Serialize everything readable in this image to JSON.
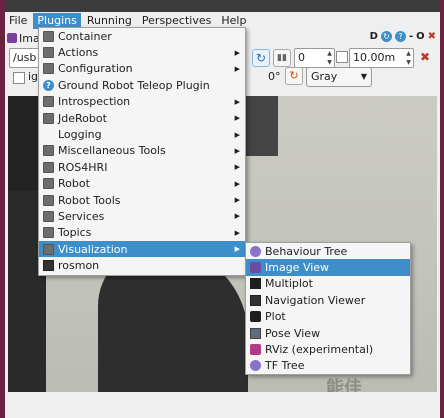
{
  "menubar": {
    "items": [
      "File",
      "Plugins",
      "Running",
      "Perspectives",
      "Help"
    ],
    "active": "Plugins"
  },
  "plugin": {
    "title": "Imag",
    "title_buttons": [
      "D",
      "?",
      "-",
      "O",
      "✖"
    ]
  },
  "toolbar": {
    "topic_value": "/usb",
    "number_value": "0",
    "distance_value": "10.00m",
    "checkbox_label": "ig",
    "rotation_label": "0°",
    "color_value": "Gray"
  },
  "plugins_menu": {
    "items": [
      {
        "label": "Container",
        "icon": "folder-icon",
        "arrow": false
      },
      {
        "label": "Actions",
        "icon": "folder-icon",
        "arrow": true
      },
      {
        "label": "Configuration",
        "icon": "folder-icon",
        "arrow": true
      },
      {
        "label": "Ground Robot Teleop Plugin",
        "icon": "help-icon",
        "arrow": false
      },
      {
        "label": "Introspection",
        "icon": "folder-icon",
        "arrow": true
      },
      {
        "label": "JdeRobot",
        "icon": "folder-icon",
        "arrow": true
      },
      {
        "label": "Logging",
        "icon": "blank-icon",
        "arrow": true
      },
      {
        "label": "Miscellaneous Tools",
        "icon": "folder-icon",
        "arrow": true
      },
      {
        "label": "ROS4HRI",
        "icon": "folder-icon",
        "arrow": true
      },
      {
        "label": "Robot",
        "icon": "folder-icon",
        "arrow": true
      },
      {
        "label": "Robot Tools",
        "icon": "folder-icon",
        "arrow": true
      },
      {
        "label": "Services",
        "icon": "folder-icon",
        "arrow": true
      },
      {
        "label": "Topics",
        "icon": "folder-icon",
        "arrow": true
      },
      {
        "label": "Visualization",
        "icon": "folder-icon",
        "arrow": true
      },
      {
        "label": "rosmon",
        "icon": "monitor-icon",
        "arrow": false
      }
    ],
    "highlighted": "Visualization"
  },
  "viz_menu": {
    "items": [
      {
        "label": "Behaviour Tree",
        "icon": "tree-icon"
      },
      {
        "label": "Image View",
        "icon": "image-icon"
      },
      {
        "label": "Multiplot",
        "icon": "multiplot-icon"
      },
      {
        "label": "Navigation Viewer",
        "icon": "monitor-icon"
      },
      {
        "label": "Plot",
        "icon": "plot-icon"
      },
      {
        "label": "Pose View",
        "icon": "pose-icon"
      },
      {
        "label": "RViz (experimental)",
        "icon": "rviz-icon"
      },
      {
        "label": "TF Tree",
        "icon": "tftree-icon"
      }
    ],
    "highlighted": "Image View"
  },
  "watermark": "能佳",
  "colors": {
    "highlight": "#3d8ec9",
    "frame": "#6b2140"
  }
}
